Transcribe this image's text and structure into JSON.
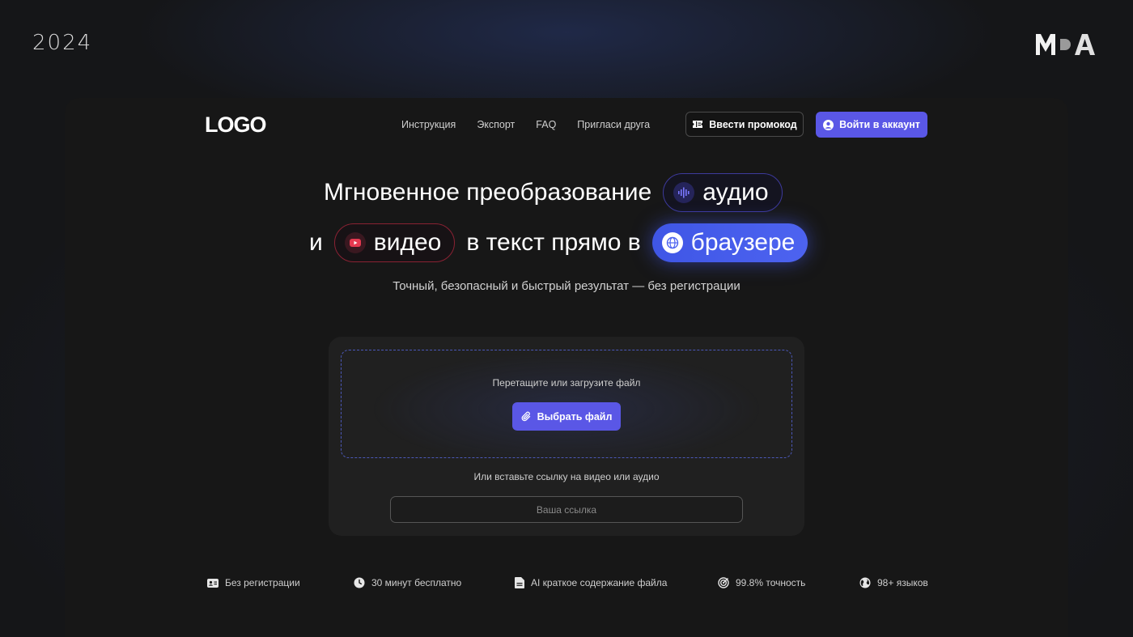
{
  "year": "2024",
  "brand": {
    "text": "MDA"
  },
  "header": {
    "logo": "LOGO",
    "nav": [
      "Инструкция",
      "Экспорт",
      "FAQ",
      "Пригласи друга"
    ],
    "promo_label": "Ввести промокод",
    "login_label": "Войти в аккаунт"
  },
  "hero": {
    "line1_text": "Мгновенное преобразование",
    "pill_audio": "аудио",
    "line2_prefix": "и",
    "pill_video": "видео",
    "line2_middle": "в текст прямо в",
    "pill_browser": "браузере",
    "subtitle": "Точный, безопасный и быстрый результат — без регистрации"
  },
  "upload": {
    "drop_text": "Перетащите или загрузите файл",
    "choose_label": "Выбрать файл",
    "or_text": "Или вставьте ссылку на видео или аудио",
    "link_placeholder": "Ваша ссылка",
    "link_value": ""
  },
  "features": [
    {
      "icon": "id-card-icon",
      "label": "Без регистрации"
    },
    {
      "icon": "clock-icon",
      "label": "30 минут бесплатно"
    },
    {
      "icon": "document-icon",
      "label": "AI краткое содержание файла"
    },
    {
      "icon": "target-icon",
      "label": "99.8% точность"
    },
    {
      "icon": "globe-icon",
      "label": "98+ языков"
    }
  ],
  "colors": {
    "accent": "#5a57e6",
    "browser_pill": "#4d63f0",
    "video_border": "#8a2233",
    "audio_border": "#3d3a9c",
    "background": "#171717"
  }
}
